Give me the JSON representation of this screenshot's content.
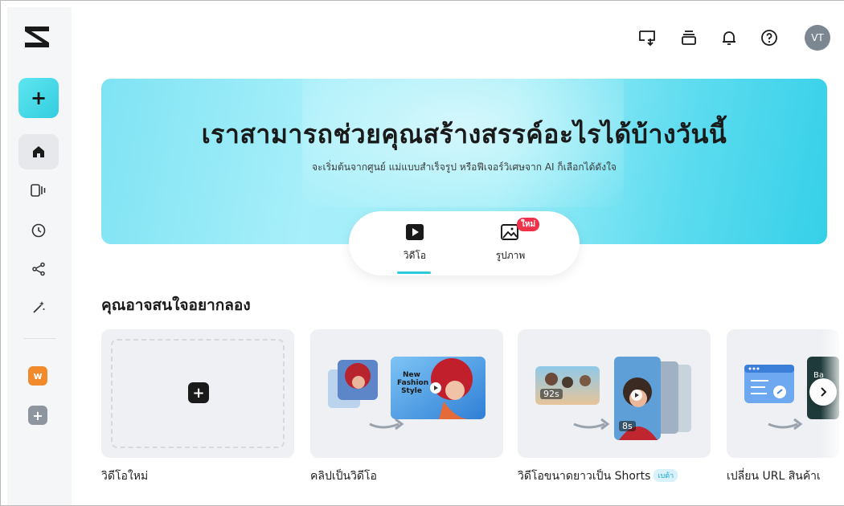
{
  "sidebar": {
    "create_label": "+",
    "items": [
      {
        "name": "home",
        "icon": "home-icon",
        "active": true
      },
      {
        "name": "templates",
        "icon": "video-frames-icon",
        "active": false
      },
      {
        "name": "recent",
        "icon": "clock-icon",
        "active": false
      },
      {
        "name": "share",
        "icon": "share-icon",
        "active": false
      },
      {
        "name": "magic",
        "icon": "magic-wand-icon",
        "active": false
      }
    ],
    "workspace_letter": "w",
    "add_workspace": "+"
  },
  "topbar": {
    "avatar_initials": "VT"
  },
  "hero": {
    "title": "เราสามารถช่วยคุณสร้างสรรค์อะไรได้บ้างวันนี้",
    "subtitle": "จะเริ่มต้นจากศูนย์ แม่แบบสำเร็จรูป หรือฟีเจอร์วิเศษจาก AI ก็เลือกได้ดังใจ"
  },
  "modes": [
    {
      "label": "วิดีโอ",
      "icon": "play-icon",
      "active": true
    },
    {
      "label": "รูปภาพ",
      "icon": "image-icon",
      "active": false,
      "badge": "ใหม่"
    }
  ],
  "section": {
    "title": "คุณอาจสนใจอยากลอง"
  },
  "cards": [
    {
      "label": "วิดีโอใหม่"
    },
    {
      "label": "คลิปเป็นวิดีโอ",
      "thumb_text": "New Fashion Style"
    },
    {
      "label": "วิดีโอขนาดยาวเป็น Shorts",
      "badge": "เบต้า",
      "duration_a": "92s",
      "duration_b": "8s"
    },
    {
      "label": "เปลี่ยน URL สินค้าเ",
      "thumb_text": "Ba"
    }
  ],
  "colors": {
    "accent": "#2ec9dc",
    "badge_red": "#f0314a",
    "workspace": "#f08a2c"
  }
}
